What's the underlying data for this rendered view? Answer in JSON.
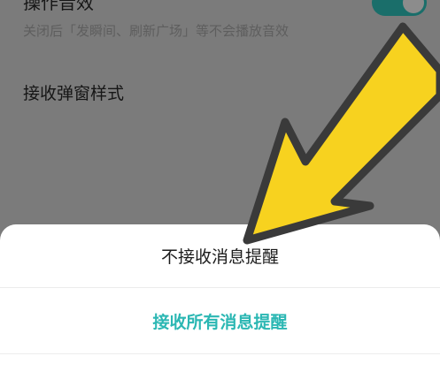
{
  "settings": {
    "operation_sound_title": "操作音效",
    "operation_sound_desc": "关闭后「发瞬间、刷新广场」等不会播放音效",
    "operation_sound_enabled": true,
    "popup_style_title": "接收弹窗样式"
  },
  "sheet": {
    "option_no_reminder": "不接收消息提醒",
    "option_all_reminders": "接收所有消息提醒"
  },
  "colors": {
    "accent": "#2bb7b3",
    "arrow_fill": "#f7d21f",
    "arrow_outline": "#3a3a3a"
  },
  "icons": {
    "overlay": "arrow-pointer-icon"
  }
}
